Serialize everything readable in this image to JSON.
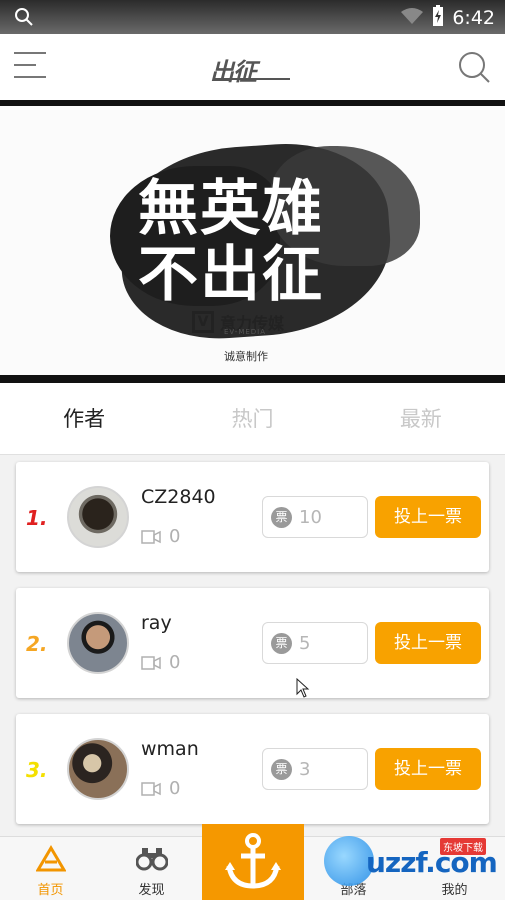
{
  "status_bar": {
    "time": "6:42"
  },
  "header": {
    "logo_text": "出征"
  },
  "banner": {
    "line1": "無英雄",
    "line2": "不出征",
    "brand_mark": "V",
    "brand_name": "意力传媒",
    "brand_sub": "EV-MEDIA",
    "caption": "诚意制作"
  },
  "tabs": [
    {
      "label": "作者",
      "active": true
    },
    {
      "label": "热门",
      "active": false
    },
    {
      "label": "最新",
      "active": false
    }
  ],
  "rank_colors": {
    "1": "#e02020",
    "2": "#f5a623",
    "3": "#f4e000"
  },
  "authors": [
    {
      "rank": "1.",
      "name": "CZ2840",
      "videos": "0",
      "votes": "10",
      "vote_button": "投上一票",
      "ticket_label": "票"
    },
    {
      "rank": "2.",
      "name": "ray",
      "videos": "0",
      "votes": "5",
      "vote_button": "投上一票",
      "ticket_label": "票"
    },
    {
      "rank": "3.",
      "name": "wman",
      "videos": "0",
      "votes": "3",
      "vote_button": "投上一票",
      "ticket_label": "票"
    }
  ],
  "bottom_nav": {
    "home": "首页",
    "discover": "发现",
    "tribe": "部落",
    "mine": "我的"
  },
  "watermark": {
    "text": "uzzf.com",
    "tag": "东坡下载"
  },
  "accent_color": "#f8a200"
}
